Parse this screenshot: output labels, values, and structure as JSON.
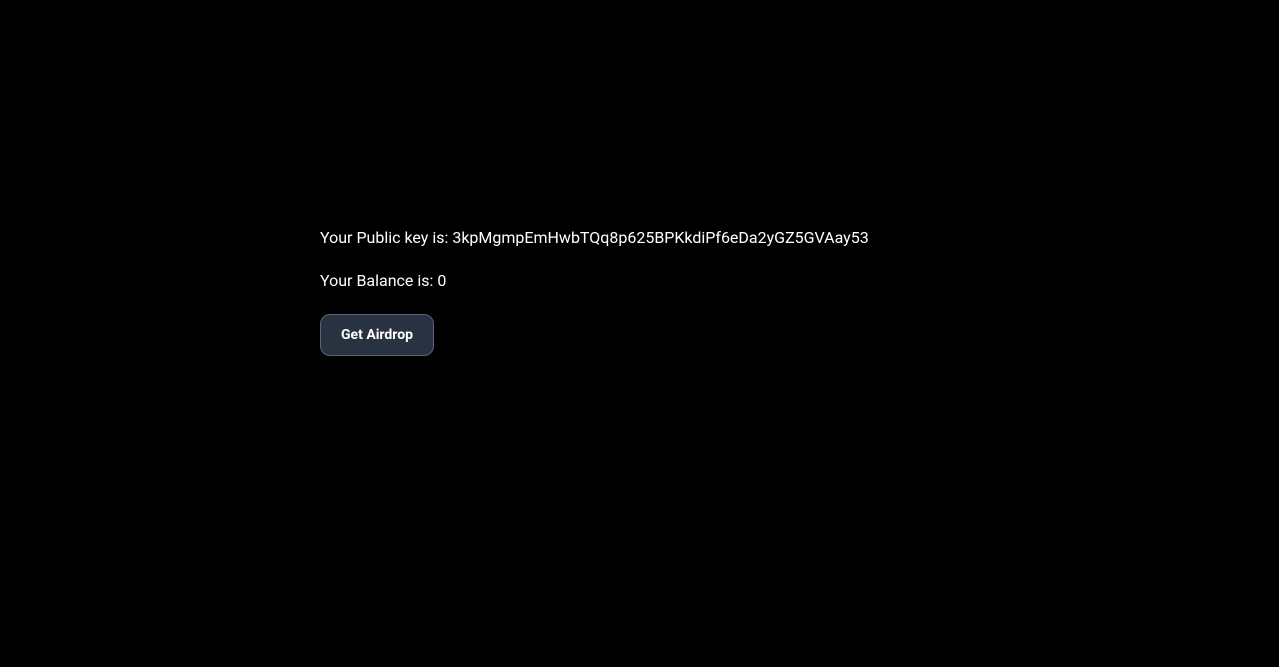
{
  "wallet": {
    "public_key_label": "Your Public key is: ",
    "public_key_value": "3kpMgmpEmHwbTQq8p625BPKkdiPf6eDa2yGZ5GVAay53",
    "balance_label": "Your Balance is: ",
    "balance_value": "0"
  },
  "actions": {
    "airdrop_button_label": "Get Airdrop"
  }
}
